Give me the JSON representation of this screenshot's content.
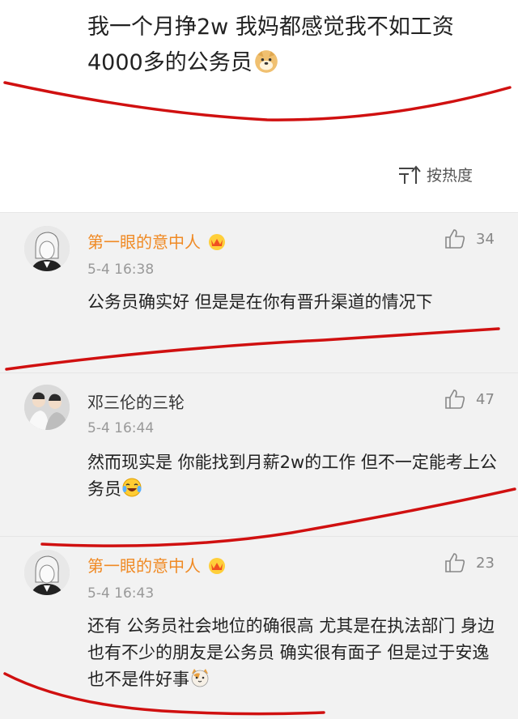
{
  "post": {
    "text_line1": "我一个月挣2w 我妈都感觉我不如工资",
    "text_line2": "4000多的公务员",
    "emoji": "doge-emoji"
  },
  "sort": {
    "label": "按热度",
    "icon": "sort-icon"
  },
  "comments": [
    {
      "name": "第一眼的意中人",
      "badge": "vip-crown-icon",
      "time": "5-4 16:38",
      "likes": "34",
      "text": "公务员确实好 但是是在你有晋升渠道的情况下"
    },
    {
      "name": "邓三伦的三轮",
      "time": "5-4 16:44",
      "likes": "47",
      "text": "然而现实是 你能找到月薪2w的工作 但不一定能考上公务员",
      "emoji": "laugh-cry-emoji"
    },
    {
      "name": "第一眼的意中人",
      "badge": "vip-crown-icon",
      "time": "5-4 16:43",
      "likes": "23",
      "text": "还有 公务员社会地位的确很高 尤其是在执法部门 身边也有不少的朋友是公务员 确实很有面子 但是过于安逸也不是件好事",
      "emoji": "cat-emoji"
    }
  ],
  "colors": {
    "vip_name": "#f08a24",
    "annotation_red": "#d01010",
    "background": "#f2f2f2"
  }
}
